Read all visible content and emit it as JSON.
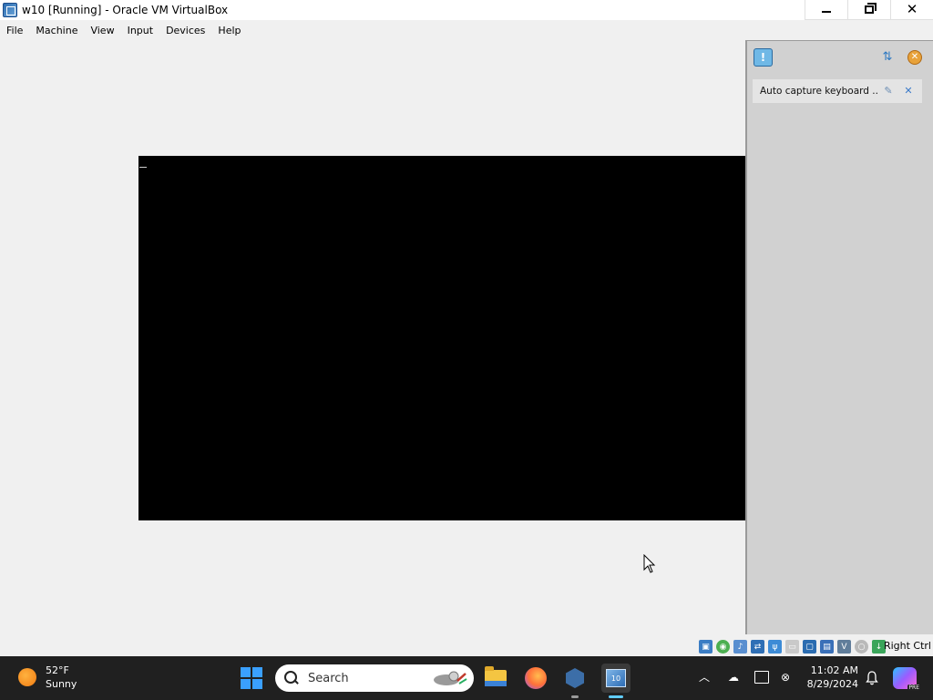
{
  "window": {
    "title": "w10 [Running] - Oracle VM VirtualBox",
    "app_icon": "virtualbox-vm-icon",
    "controls": [
      "minimize-icon",
      "restore-icon",
      "close-icon"
    ]
  },
  "menubar": {
    "items": [
      "File",
      "Machine",
      "View",
      "Input",
      "Devices",
      "Help"
    ]
  },
  "notification_panel": {
    "notice_text": "Auto capture keyboard ...",
    "icons": [
      "info-icon",
      "sort-icon",
      "close-all-icon",
      "do-not-show-icon",
      "dismiss-icon"
    ]
  },
  "statusbar": {
    "host_key_label": "Right Ctrl",
    "icons": [
      "hard-disk-icon",
      "optical-drive-icon",
      "audio-icon",
      "network-icon",
      "usb-icon",
      "shared-folders-icon",
      "display-icon",
      "video-capture-icon",
      "virtualization-icon",
      "mouse-integration-icon",
      "keyboard-icon"
    ]
  },
  "taskbar": {
    "weather": {
      "temperature": "52°F",
      "condition": "Sunny"
    },
    "search_placeholder": "Search",
    "apps": [
      "start-icon",
      "file-explorer-icon",
      "firefox-icon",
      "virtualbox-manager-icon",
      "virtualbox-vm-icon"
    ],
    "clock": {
      "time": "11:02 AM",
      "date": "8/29/2024"
    },
    "tray_icons": [
      "chevron-up-icon",
      "onedrive-icon",
      "display-icon",
      "network-icon",
      "bell-icon",
      "copilot-icon"
    ],
    "copilot_badge": "PRE"
  },
  "colors": {
    "taskbar_bg": "#202020",
    "vm_screen": "#000000",
    "panel_bg": "#d1d1d1",
    "accent": "#60cdff"
  }
}
